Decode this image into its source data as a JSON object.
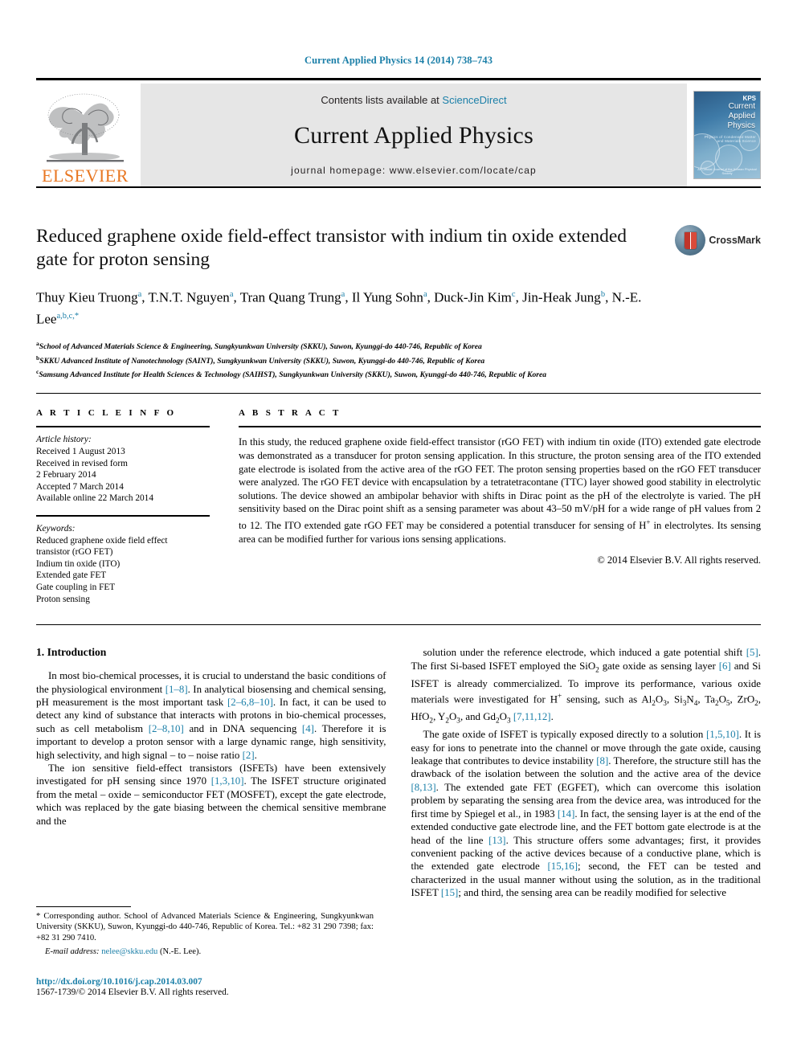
{
  "running_head": "Current Applied Physics 14 (2014) 738–743",
  "masthead": {
    "publisher": "ELSEVIER",
    "contents_prefix": "Contents lists available at ",
    "contents_link": "ScienceDirect",
    "journal_name": "Current Applied Physics",
    "homepage": "journal homepage: www.elsevier.com/locate/cap",
    "cover": {
      "line1": "Current",
      "line2": "Applied",
      "line3": "Physics",
      "subtitle": "Physics of Condensed Matter and Materials Science",
      "corner": "KPS",
      "footer": "An Official Journal of the Korean Physical Society"
    }
  },
  "article": {
    "title": "Reduced graphene oxide field-effect transistor with indium tin oxide extended gate for proton sensing",
    "crossmark_label": "CrossMark",
    "authors": [
      {
        "name": "Thuy Kieu Truong",
        "marks": "a"
      },
      {
        "name": "T.N.T. Nguyen",
        "marks": "a"
      },
      {
        "name": "Tran Quang Trung",
        "marks": "a"
      },
      {
        "name": "Il Yung Sohn",
        "marks": "a"
      },
      {
        "name": "Duck-Jin Kim",
        "marks": "c"
      },
      {
        "name": "Jin-Heak Jung",
        "marks": "b"
      },
      {
        "name": "N.-E. Lee",
        "marks": "a,b,c,*"
      }
    ],
    "affiliations": [
      {
        "mark": "a",
        "text": "School of Advanced Materials Science & Engineering, Sungkyunkwan University (SKKU), Suwon, Kyunggi-do 440-746, Republic of Korea"
      },
      {
        "mark": "b",
        "text": "SKKU Advanced Institute of Nanotechnology (SAINT), Sungkyunkwan University (SKKU), Suwon, Kyunggi-do 440-746, Republic of Korea"
      },
      {
        "mark": "c",
        "text": "Samsung Advanced Institute for Health Sciences & Technology (SAIHST), Sungkyunkwan University (SKKU), Suwon, Kyunggi-do 440-746, Republic of Korea"
      }
    ]
  },
  "article_info": {
    "heading": "A R T I C L E   I N F O",
    "history_label": "Article history:",
    "history": [
      "Received 1 August 2013",
      "Received in revised form",
      "2 February 2014",
      "Accepted 7 March 2014",
      "Available online 22 March 2014"
    ],
    "keywords_label": "Keywords:",
    "keywords": [
      "Reduced graphene oxide field effect",
      "transistor (rGO FET)",
      "Indium tin oxide (ITO)",
      "Extended gate FET",
      "Gate coupling in FET",
      "Proton sensing"
    ]
  },
  "abstract": {
    "heading": "A B S T R A C T",
    "text": "In this study, the reduced graphene oxide field-effect transistor (rGO FET) with indium tin oxide (ITO) extended gate electrode was demonstrated as a transducer for proton sensing application. In this structure, the proton sensing area of the ITO extended gate electrode is isolated from the active area of the rGO FET. The proton sensing properties based on the rGO FET transducer were analyzed. The rGO FET device with encapsulation by a tetratetracontane (TTC) layer showed good stability in electrolytic solutions. The device showed an ambipolar behavior with shifts in Dirac point as the pH of the electrolyte is varied. The pH sensitivity based on the Dirac point shift as a sensing parameter was about 43–50 mV/pH for a wide range of pH values from 2 to 12. The ITO extended gate rGO FET may be considered a potential transducer for sensing of H",
    "text_after_sup": " in electrolytes. Its sensing area can be modified further for various ions sensing applications.",
    "superscript": "+",
    "copyright": "© 2014 Elsevier B.V. All rights reserved."
  },
  "body": {
    "section_heading": "1. Introduction",
    "left_paragraphs": [
      {
        "parts": [
          {
            "t": "In most bio-chemical processes, it is crucial to understand the basic conditions of the physiological environment "
          },
          {
            "t": "[1–8]",
            "ref": true
          },
          {
            "t": ". In analytical biosensing and chemical sensing, pH measurement is the most important task "
          },
          {
            "t": "[2–6,8–10]",
            "ref": true
          },
          {
            "t": ". In fact, it can be used to detect any kind of substance that interacts with protons in bio-chemical processes, such as cell metabolism "
          },
          {
            "t": "[2–8,10]",
            "ref": true
          },
          {
            "t": " and in DNA sequencing "
          },
          {
            "t": "[4]",
            "ref": true
          },
          {
            "t": ". Therefore it is important to develop a proton sensor with a large dynamic range, high sensitivity, high selectivity, and high signal – to – noise ratio "
          },
          {
            "t": "[2]",
            "ref": true
          },
          {
            "t": "."
          }
        ]
      },
      {
        "parts": [
          {
            "t": "The ion sensitive field-effect transistors (ISFETs) have been extensively investigated for pH sensing since 1970 "
          },
          {
            "t": "[1,3,10]",
            "ref": true
          },
          {
            "t": ". The ISFET structure originated from the metal – oxide – semiconductor FET (MOSFET), except the gate electrode, which was replaced by the gate biasing between the chemical sensitive membrane and the"
          }
        ]
      }
    ],
    "right_paragraphs": [
      {
        "parts": [
          {
            "t": "solution under the reference electrode, which induced a gate potential shift "
          },
          {
            "t": "[5]",
            "ref": true
          },
          {
            "t": ". The first Si-based ISFET employed the SiO"
          },
          {
            "t": "2",
            "sub": true
          },
          {
            "t": " gate oxide as sensing layer "
          },
          {
            "t": "[6]",
            "ref": true
          },
          {
            "t": " and Si ISFET is already commercialized. To improve its performance, various oxide materials were investigated for H"
          },
          {
            "t": "+",
            "sup": true
          },
          {
            "t": " sensing, such as Al"
          },
          {
            "t": "2",
            "sub": true
          },
          {
            "t": "O"
          },
          {
            "t": "3",
            "sub": true
          },
          {
            "t": ", Si"
          },
          {
            "t": "3",
            "sub": true
          },
          {
            "t": "N"
          },
          {
            "t": "4",
            "sub": true
          },
          {
            "t": ", Ta"
          },
          {
            "t": "2",
            "sub": true
          },
          {
            "t": "O"
          },
          {
            "t": "5",
            "sub": true
          },
          {
            "t": ", ZrO"
          },
          {
            "t": "2",
            "sub": true
          },
          {
            "t": ", HfO"
          },
          {
            "t": "2",
            "sub": true
          },
          {
            "t": ", Y"
          },
          {
            "t": "2",
            "sub": true
          },
          {
            "t": "O"
          },
          {
            "t": "3",
            "sub": true
          },
          {
            "t": ", and Gd"
          },
          {
            "t": "2",
            "sub": true
          },
          {
            "t": "O"
          },
          {
            "t": "3",
            "sub": true
          },
          {
            "t": " "
          },
          {
            "t": "[7,11,12]",
            "ref": true
          },
          {
            "t": "."
          }
        ]
      },
      {
        "parts": [
          {
            "t": "The gate oxide of ISFET is typically exposed directly to a solution "
          },
          {
            "t": "[1,5,10]",
            "ref": true
          },
          {
            "t": ". It is easy for ions to penetrate into the channel or move through the gate oxide, causing leakage that contributes to device instability "
          },
          {
            "t": "[8]",
            "ref": true
          },
          {
            "t": ". Therefore, the structure still has the drawback of the isolation between the solution and the active area of the device "
          },
          {
            "t": "[8,13]",
            "ref": true
          },
          {
            "t": ". The extended gate FET (EGFET), which can overcome this isolation problem by separating the sensing area from the device area, was introduced for the first time by Spiegel et al., in 1983 "
          },
          {
            "t": "[14]",
            "ref": true
          },
          {
            "t": ". In fact, the sensing layer is at the end of the extended conductive gate electrode line, and the FET bottom gate electrode is at the head of the line "
          },
          {
            "t": "[13]",
            "ref": true
          },
          {
            "t": ". This structure offers some advantages; first, it provides convenient packing of the active devices because of a conductive plane, which is the extended gate electrode "
          },
          {
            "t": "[15,16]",
            "ref": true
          },
          {
            "t": "; second, the FET can be tested and characterized in the usual manner without using the solution, as in the traditional ISFET "
          },
          {
            "t": "[15]",
            "ref": true
          },
          {
            "t": "; and third, the sensing area can be readily modified for selective"
          }
        ]
      }
    ]
  },
  "footnote": {
    "corresponding": "* Corresponding author. School of Advanced Materials Science & Engineering, Sungkyunkwan University (SKKU), Suwon, Kyunggi-do 440-746, Republic of Korea. Tel.: +82 31 290 7398; fax: +82 31 290 7410.",
    "email_label": "E-mail address:",
    "email": "nelee@skku.edu",
    "email_suffix": "(N.-E. Lee).",
    "doi": "http://dx.doi.org/10.1016/j.cap.2014.03.007",
    "issn": "1567-1739/© 2014 Elsevier B.V. All rights reserved."
  },
  "colors": {
    "link": "#1b7fa8",
    "elsevier_orange": "#E87722",
    "masthead_gray": "#e6e6e6"
  }
}
